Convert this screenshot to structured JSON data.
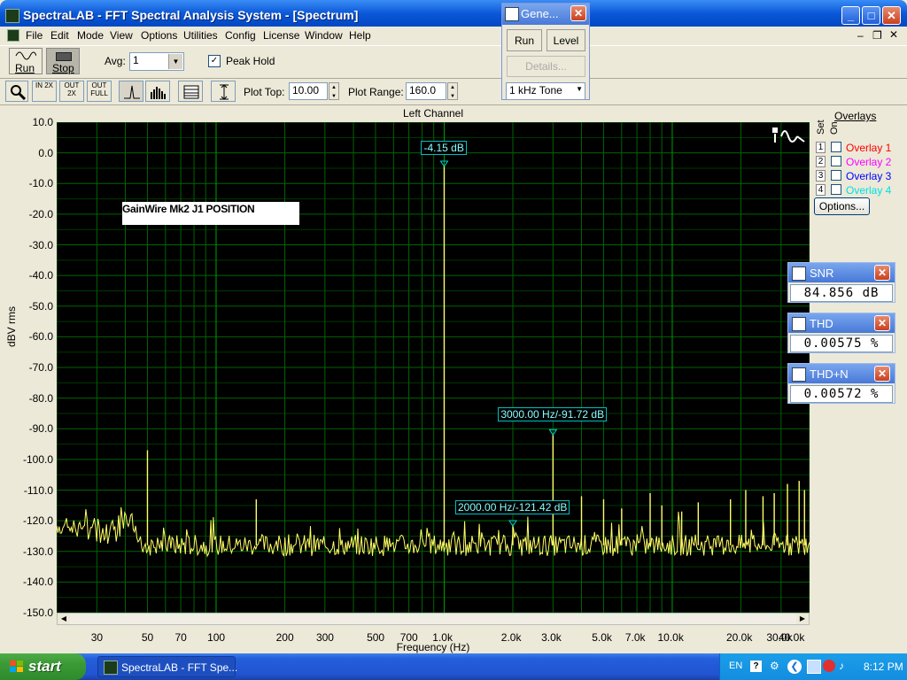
{
  "window": {
    "title": "SpectraLAB - FFT Spectral Analysis System - [Spectrum]"
  },
  "menu": [
    "File",
    "Edit",
    "Mode",
    "View",
    "Options",
    "Utilities",
    "Config",
    "License",
    "Window",
    "Help"
  ],
  "toolbar": {
    "run_label": "Run",
    "stop_label": "Stop",
    "avg_label": "Avg:",
    "avg_value": "1",
    "peak_hold_label": "Peak Hold",
    "peak_hold_checked": true,
    "zoom_in_label": "IN 2X",
    "zoom_out_label": "OUT 2X",
    "zoom_full_label": "OUT FULL",
    "plot_top_label": "Plot Top:",
    "plot_top_value": "10.00",
    "plot_range_label": "Plot Range:",
    "plot_range_value": "160.0"
  },
  "generator": {
    "title": "Gene...",
    "run_label": "Run",
    "level_label": "Level",
    "details_label": "Details...",
    "signal_value": "1 kHz Tone"
  },
  "plot": {
    "channel_title": "Left Channel",
    "annotation": "GainWire Mk2 J1 POSITION",
    "markers": [
      {
        "label": "-4.15 dB"
      },
      {
        "label": "3000.00 Hz/-91.72 dB"
      },
      {
        "label": "2000.00 Hz/-121.42 dB"
      }
    ]
  },
  "overlays": {
    "title": "Overlays",
    "set_label": "Set",
    "on_label": "On",
    "items": [
      {
        "num": "1",
        "label": "Overlay 1",
        "color": "#ff0000"
      },
      {
        "num": "2",
        "label": "Overlay 2",
        "color": "#ff00ff"
      },
      {
        "num": "3",
        "label": "Overlay 3",
        "color": "#0000ff"
      },
      {
        "num": "4",
        "label": "Overlay 4",
        "color": "#00e0e0"
      }
    ],
    "options_label": "Options..."
  },
  "meters": [
    {
      "name": "SNR",
      "value": "84.856 dB"
    },
    {
      "name": "THD",
      "value": "0.00575 %"
    },
    {
      "name": "THD+N",
      "value": "0.00572 %"
    }
  ],
  "taskbar": {
    "start_label": "start",
    "task_label": "SpectraLAB - FFT Spe...",
    "lang": "EN",
    "clock": "8:12 PM"
  },
  "chart_data": {
    "type": "line",
    "title": "Left Channel",
    "xlabel": "Frequency (Hz)",
    "ylabel": "dBV rms",
    "x_scale": "log",
    "xlim": [
      20,
      40000
    ],
    "ylim": [
      -150,
      10
    ],
    "grid": true,
    "y_ticks": [
      "10.0",
      "0.0",
      "-10.0",
      "-20.0",
      "-30.0",
      "-40.0",
      "-50.0",
      "-60.0",
      "-70.0",
      "-80.0",
      "-90.0",
      "-100.0",
      "-110.0",
      "-120.0",
      "-130.0",
      "-140.0",
      "-150.0"
    ],
    "x_ticks": [
      {
        "v": 30,
        "label": "30"
      },
      {
        "v": 50,
        "label": "50"
      },
      {
        "v": 70,
        "label": "70"
      },
      {
        "v": 100,
        "label": "100"
      },
      {
        "v": 200,
        "label": "200"
      },
      {
        "v": 300,
        "label": "300"
      },
      {
        "v": 500,
        "label": "500"
      },
      {
        "v": 700,
        "label": "700"
      },
      {
        "v": 1000,
        "label": "1.0k"
      },
      {
        "v": 2000,
        "label": "2.0k"
      },
      {
        "v": 3000,
        "label": "3.0k"
      },
      {
        "v": 5000,
        "label": "5.0k"
      },
      {
        "v": 7000,
        "label": "7.0k"
      },
      {
        "v": 10000,
        "label": "10.0k"
      },
      {
        "v": 20000,
        "label": "20.0k"
      },
      {
        "v": 30000,
        "label": "30.0k"
      },
      {
        "v": 40000,
        "label": "40.0k"
      }
    ],
    "noise_floor_db": -128,
    "series": [
      {
        "color": "#ffff66",
        "peaks": [
          {
            "x": 1000,
            "y": -4.15
          },
          {
            "x": 3000,
            "y": -91.72
          },
          {
            "x": 2000,
            "y": -121.42
          },
          {
            "x": 50,
            "y": -97
          },
          {
            "x": 150,
            "y": -113
          },
          {
            "x": 4000,
            "y": -112
          },
          {
            "x": 5000,
            "y": -113
          },
          {
            "x": 6000,
            "y": -116
          },
          {
            "x": 8000,
            "y": -111
          },
          {
            "x": 9000,
            "y": -115
          },
          {
            "x": 11000,
            "y": -117
          },
          {
            "x": 13000,
            "y": -114
          },
          {
            "x": 18000,
            "y": -113
          },
          {
            "x": 21000,
            "y": -110
          },
          {
            "x": 25000,
            "y": -112
          },
          {
            "x": 28000,
            "y": -111
          },
          {
            "x": 32000,
            "y": -108
          },
          {
            "x": 36000,
            "y": -107
          },
          {
            "x": 38000,
            "y": -110
          }
        ]
      }
    ],
    "markers": [
      {
        "x": 1000,
        "y": -4.15,
        "label": "-4.15 dB"
      },
      {
        "x": 3000,
        "y": -91.72,
        "label": "3000.00 Hz/-91.72 dB"
      },
      {
        "x": 2000,
        "y": -121.42,
        "label": "2000.00 Hz/-121.42 dB"
      }
    ]
  }
}
